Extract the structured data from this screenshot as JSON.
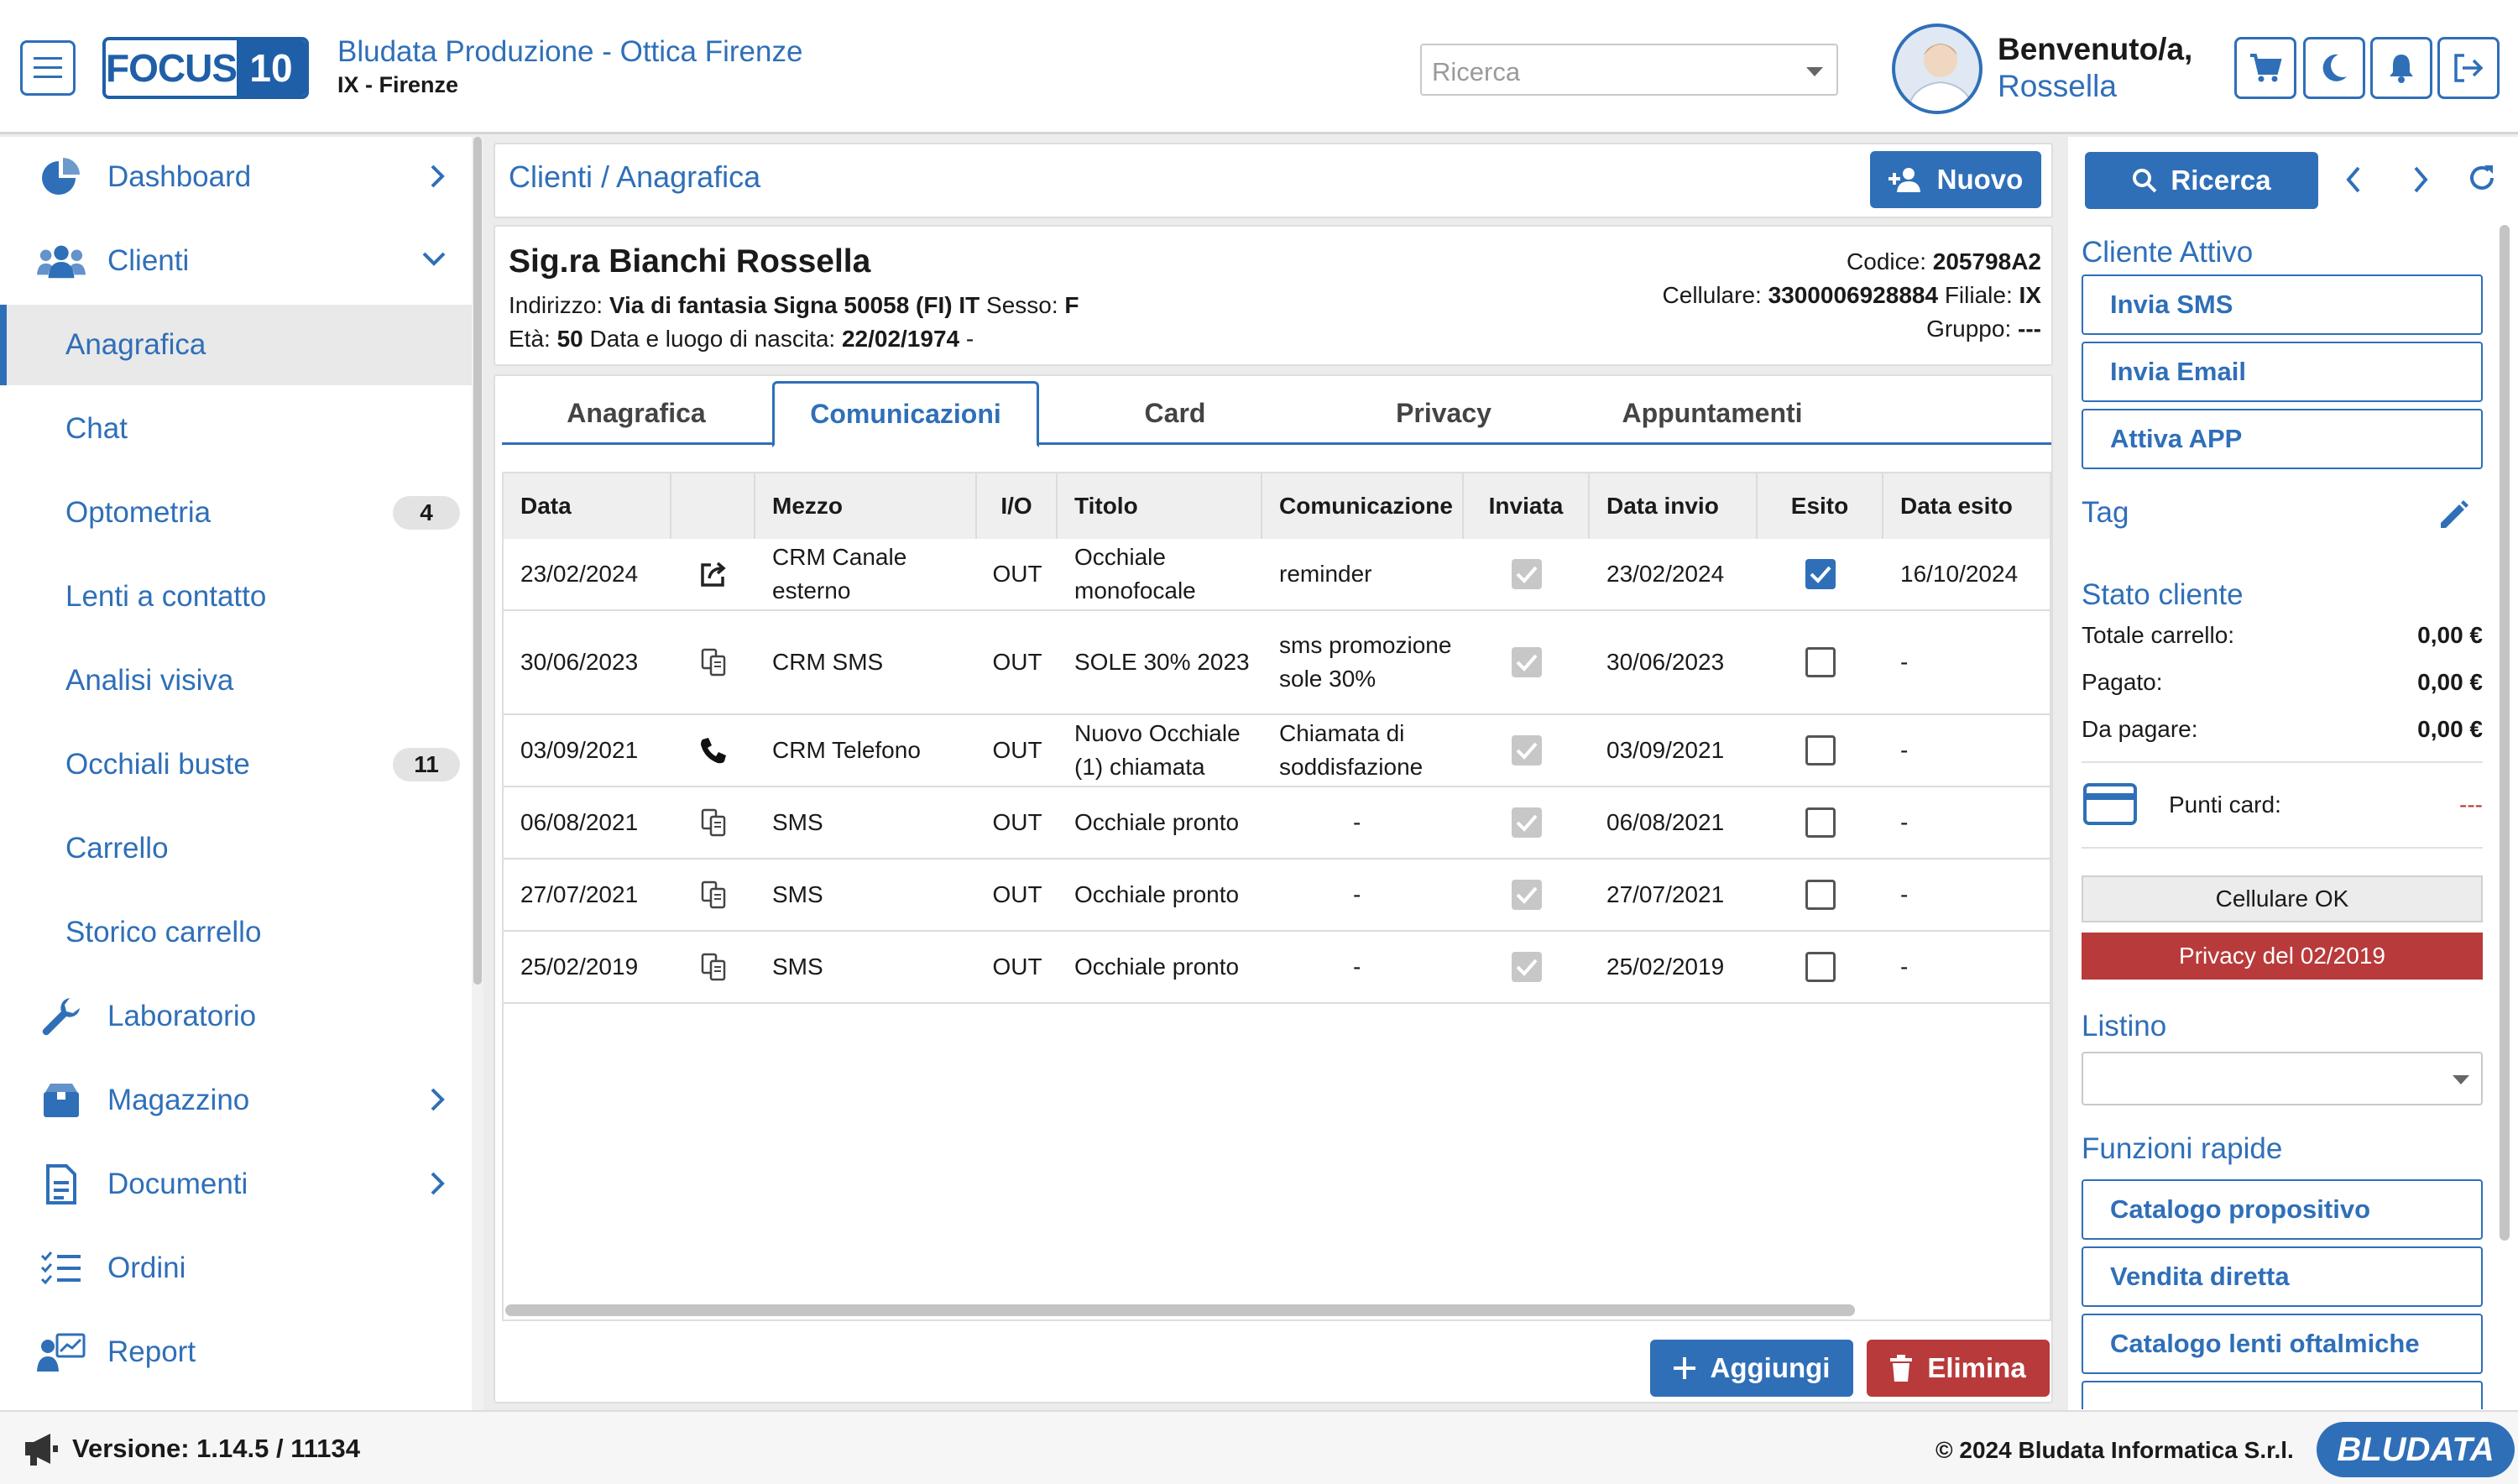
{
  "header": {
    "logo_left": "FOCUS",
    "logo_right": "10",
    "company": "Bludata Produzione - Ottica Firenze",
    "branch": "IX - Firenze",
    "search_placeholder": "Ricerca",
    "welcome": "Benvenuto/a,",
    "user": "Rossella",
    "icons": [
      "menu-icon",
      "cart-icon",
      "moon-icon",
      "bell-icon",
      "logout-icon"
    ]
  },
  "sidebar": {
    "items": [
      {
        "label": "Dashboard",
        "icon": "pie-chart-icon"
      },
      {
        "label": "Clienti",
        "icon": "users-icon"
      },
      {
        "label": "Anagrafica"
      },
      {
        "label": "Chat"
      },
      {
        "label": "Optometria",
        "badge": "4"
      },
      {
        "label": "Lenti a contatto"
      },
      {
        "label": "Analisi visiva"
      },
      {
        "label": "Occhiali buste",
        "badge": "11"
      },
      {
        "label": "Carrello"
      },
      {
        "label": "Storico carrello"
      },
      {
        "label": "Laboratorio",
        "icon": "wrench-icon"
      },
      {
        "label": "Magazzino",
        "icon": "box-icon"
      },
      {
        "label": "Documenti",
        "icon": "document-icon"
      },
      {
        "label": "Ordini",
        "icon": "checklist-icon"
      },
      {
        "label": "Report",
        "icon": "report-icon"
      }
    ]
  },
  "main": {
    "breadcrumb": "Clienti / Anagrafica",
    "new_button": "Nuovo",
    "customer": {
      "name": "Sig.ra Bianchi Rossella",
      "address_label": "Indirizzo:",
      "address": "Via di fantasia Signa 50058 (FI) IT",
      "sex_label": "Sesso:",
      "sex": "F",
      "age_label": "Età:",
      "age": "50",
      "birth_label": "Data e luogo di nascita:",
      "birth": "22/02/1974",
      "birth_suffix": "-",
      "code_label": "Codice:",
      "code": "205798A2",
      "phone_label": "Cellulare:",
      "phone": "3300006928884",
      "branch_label": "Filiale:",
      "branch": "IX",
      "group_label": "Gruppo:",
      "group": "---"
    },
    "tabs": [
      "Anagrafica",
      "Comunicazioni",
      "Card",
      "Privacy",
      "Appuntamenti"
    ],
    "active_tab": "Comunicazioni",
    "table": {
      "headers": [
        "Data",
        "",
        "Mezzo",
        "I/O",
        "Titolo",
        "Comunicazione",
        "Inviata",
        "Data invio",
        "Esito",
        "Data esito"
      ],
      "rows": [
        {
          "data": "23/02/2024",
          "icon": "share-icon",
          "mezzo": "CRM Canale esterno",
          "io": "OUT",
          "titolo": "Occhiale monofocale",
          "comunicazione": "reminder",
          "inviata": true,
          "data_invio": "23/02/2024",
          "esito": true,
          "data_esito": "16/10/2024"
        },
        {
          "data": "30/06/2023",
          "icon": "sms-icon",
          "mezzo": "CRM SMS",
          "io": "OUT",
          "titolo": "SOLE 30% 2023",
          "comunicazione": "sms promozione sole 30%",
          "inviata": true,
          "data_invio": "30/06/2023",
          "esito": false,
          "data_esito": "-"
        },
        {
          "data": "03/09/2021",
          "icon": "phone-icon",
          "mezzo": "CRM Telefono",
          "io": "OUT",
          "titolo": "Nuovo Occhiale (1) chiamata",
          "comunicazione": "Chiamata di soddisfazione",
          "inviata": true,
          "data_invio": "03/09/2021",
          "esito": false,
          "data_esito": "-"
        },
        {
          "data": "06/08/2021",
          "icon": "sms-icon",
          "mezzo": "SMS",
          "io": "OUT",
          "titolo": "Occhiale pronto",
          "comunicazione": "-",
          "inviata": true,
          "data_invio": "06/08/2021",
          "esito": false,
          "data_esito": "-"
        },
        {
          "data": "27/07/2021",
          "icon": "sms-icon",
          "mezzo": "SMS",
          "io": "OUT",
          "titolo": "Occhiale pronto",
          "comunicazione": "-",
          "inviata": true,
          "data_invio": "27/07/2021",
          "esito": false,
          "data_esito": "-"
        },
        {
          "data": "25/02/2019",
          "icon": "sms-icon",
          "mezzo": "SMS",
          "io": "OUT",
          "titolo": "Occhiale pronto",
          "comunicazione": "-",
          "inviata": true,
          "data_invio": "25/02/2019",
          "esito": false,
          "data_esito": "-"
        }
      ]
    },
    "add_button": "Aggiungi",
    "delete_button": "Elimina"
  },
  "right": {
    "search_button": "Ricerca",
    "active_title": "Cliente Attivo",
    "actions": [
      "Invia SMS",
      "Invia Email",
      "Attiva APP"
    ],
    "tag_title": "Tag",
    "status_title": "Stato cliente",
    "totale_label": "Totale carrello:",
    "totale": "0,00 €",
    "pagato_label": "Pagato:",
    "pagato": "0,00 €",
    "da_pagare_label": "Da pagare:",
    "da_pagare": "0,00 €",
    "punti_label": "Punti card:",
    "punti": "---",
    "cell_status": "Cellulare OK",
    "privacy_status": "Privacy del 02/2019",
    "listino_title": "Listino",
    "funzioni_title": "Funzioni rapide",
    "funzioni": [
      "Catalogo propositivo",
      "Vendita diretta",
      "Catalogo lenti oftalmiche"
    ],
    "colors": {
      "accent": "#2f6fb8",
      "danger": "#b83a3a"
    }
  },
  "footer": {
    "version": "Versione: 1.14.5 / 11134",
    "copyright": "© 2024 Bludata Informatica S.r.l.",
    "brand": "BLUDATA"
  }
}
